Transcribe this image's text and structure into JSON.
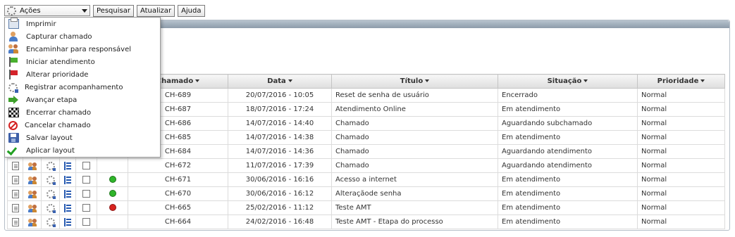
{
  "toolbar": {
    "actions_select_value": "Ações",
    "search_label": "Pesquisar",
    "refresh_label": "Atualizar",
    "help_label": "Ajuda"
  },
  "menu": {
    "items": [
      {
        "label": "Imprimir",
        "icon": "print-icon"
      },
      {
        "label": "Capturar chamado",
        "icon": "user-icon"
      },
      {
        "label": "Encaminhar para responsável",
        "icon": "users-icon"
      },
      {
        "label": "Iniciar atendimento",
        "icon": "green-flag-icon"
      },
      {
        "label": "Alterar prioridade",
        "icon": "red-flag-icon"
      },
      {
        "label": "Registrar acompanhamento",
        "icon": "tracking-icon"
      },
      {
        "label": "Avançar etapa",
        "icon": "arrow-right-icon"
      },
      {
        "label": "Encerrar chamado",
        "icon": "finish-flag-icon"
      },
      {
        "label": "Cancelar chamado",
        "icon": "cancel-icon"
      },
      {
        "label": "Salvar layout",
        "icon": "save-icon"
      },
      {
        "label": "Aplicar layout",
        "icon": "check-icon"
      }
    ]
  },
  "grid": {
    "headers": {
      "chamado": "Chamado",
      "data": "Data",
      "titulo": "Título",
      "situacao": "Situação",
      "prioridade": "Prioridade"
    },
    "rows": [
      {
        "chamado": "CH-689",
        "data": "20/07/2016 - 10:05",
        "titulo": "Reset de senha de usuário",
        "situacao": "Encerrado",
        "prioridade": "Normal",
        "status": ""
      },
      {
        "chamado": "CH-687",
        "data": "18/07/2016 - 17:24",
        "titulo": "Atendimento Online",
        "situacao": "Em atendimento",
        "prioridade": "Normal",
        "status": ""
      },
      {
        "chamado": "CH-686",
        "data": "14/07/2016 - 14:40",
        "titulo": "Chamado",
        "situacao": "Aguardando subchamado",
        "prioridade": "Normal",
        "status": ""
      },
      {
        "chamado": "CH-685",
        "data": "14/07/2016 - 14:38",
        "titulo": "Chamado",
        "situacao": "Em atendimento",
        "prioridade": "Normal",
        "status": ""
      },
      {
        "chamado": "CH-684",
        "data": "14/07/2016 - 14:36",
        "titulo": "Chamado",
        "situacao": "Aguardando atendimento",
        "prioridade": "Normal",
        "status": ""
      },
      {
        "chamado": "CH-672",
        "data": "11/07/2016 - 17:39",
        "titulo": "Chamado",
        "situacao": "Aguardando atendimento",
        "prioridade": "Normal",
        "status": ""
      },
      {
        "chamado": "CH-671",
        "data": "30/06/2016 - 16:16",
        "titulo": "Acesso a internet",
        "situacao": "Em atendimento",
        "prioridade": "Normal",
        "status": "green"
      },
      {
        "chamado": "CH-670",
        "data": "30/06/2016 - 16:12",
        "titulo": "Alteraçãode senha",
        "situacao": "Em atendimento",
        "prioridade": "Normal",
        "status": "green"
      },
      {
        "chamado": "CH-665",
        "data": "25/02/2016 - 11:12",
        "titulo": "Teste AMT",
        "situacao": "Em atendimento",
        "prioridade": "Normal",
        "status": "red"
      },
      {
        "chamado": "CH-664",
        "data": "24/02/2016 - 16:48",
        "titulo": "Teste AMT - Etapa do processo",
        "situacao": "Em atendimento",
        "prioridade": "Normal",
        "status": ""
      }
    ]
  },
  "colors": {
    "status_green": "#2fb52a",
    "status_red": "#d8231f",
    "panel_header": "#97a5b3"
  }
}
